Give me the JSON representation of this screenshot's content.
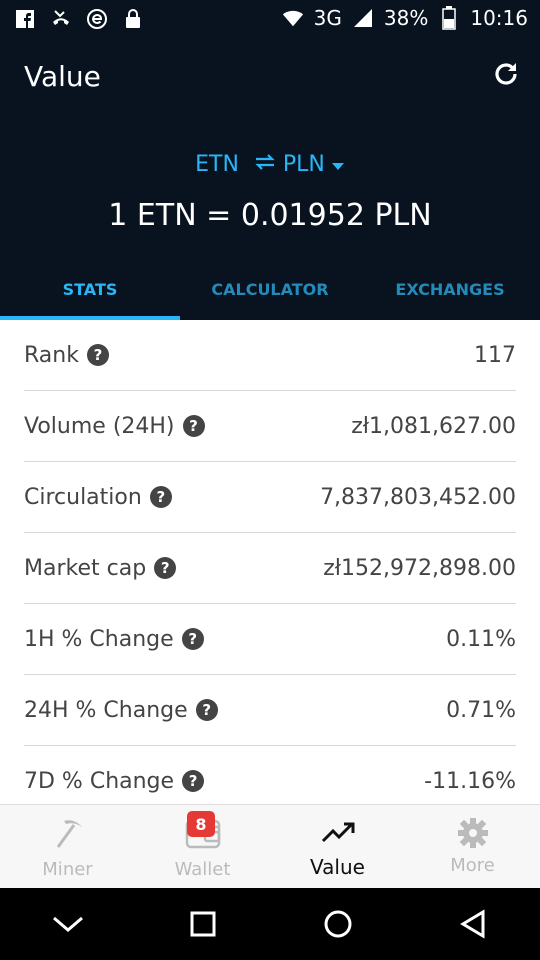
{
  "status_bar": {
    "network": "3G",
    "battery": "38%",
    "time": "10:16"
  },
  "header": {
    "title": "Value",
    "pair_from": "ETN",
    "pair_to": "PLN",
    "rate": "1 ETN = 0.01952 PLN"
  },
  "tabs": [
    {
      "label": "STATS",
      "active": true
    },
    {
      "label": "CALCULATOR",
      "active": false
    },
    {
      "label": "EXCHANGES",
      "active": false
    }
  ],
  "stats": [
    {
      "label": "Rank",
      "value": "117"
    },
    {
      "label": "Volume (24H)",
      "value": "zł1,081,627.00"
    },
    {
      "label": "Circulation",
      "value": "7,837,803,452.00"
    },
    {
      "label": "Market cap",
      "value": "zł152,972,898.00"
    },
    {
      "label": "1H % Change",
      "value": "0.11%"
    },
    {
      "label": "24H % Change",
      "value": "0.71%"
    },
    {
      "label": "7D % Change",
      "value": "-11.16%"
    }
  ],
  "help_glyph": "?",
  "bottom_nav": [
    {
      "label": "Miner",
      "icon": "pickaxe-icon"
    },
    {
      "label": "Wallet",
      "icon": "wallet-icon",
      "badge": "8"
    },
    {
      "label": "Value",
      "icon": "trending-up-icon",
      "active": true
    },
    {
      "label": "More",
      "icon": "gear-icon"
    }
  ],
  "colors": {
    "header_bg": "#08131f",
    "accent": "#29b6f6",
    "badge": "#e53935"
  }
}
